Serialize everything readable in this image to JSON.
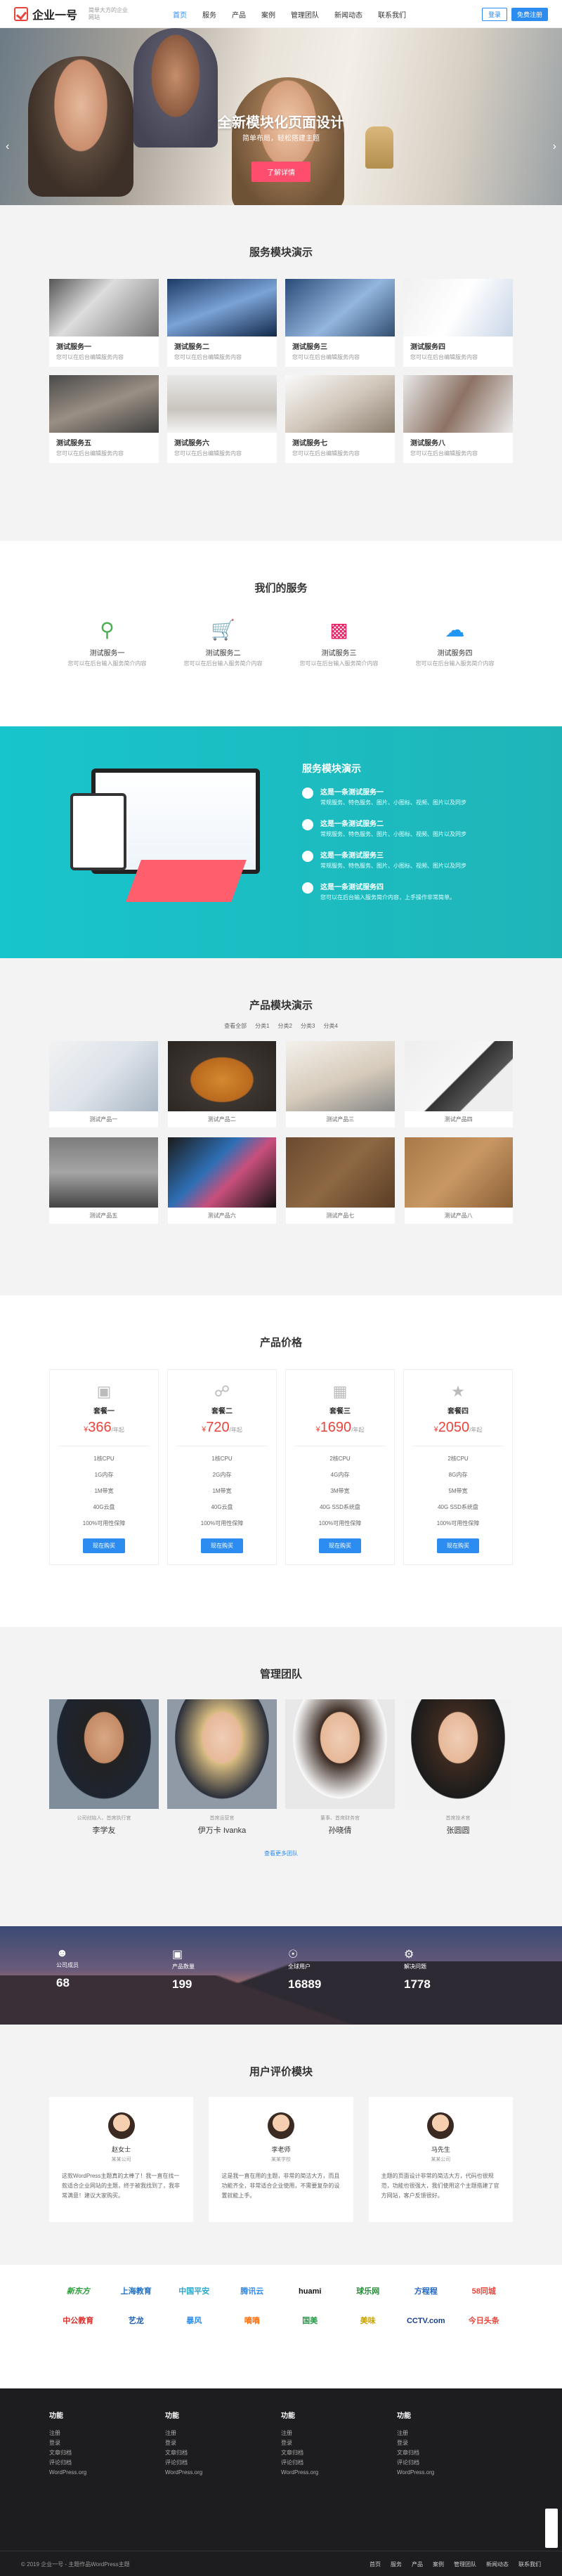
{
  "header": {
    "logo": "企业一号",
    "logo_sub": "简单大方的企业网站",
    "nav": [
      "首页",
      "服务",
      "产品",
      "案例",
      "管理团队",
      "新闻动态",
      "联系我们"
    ],
    "btn_login": "登录",
    "btn_signup": "免费注册"
  },
  "hero": {
    "title": "全新模块化页面设计",
    "subtitle": "简单布局，轻松搭建主题",
    "button": "了解详情"
  },
  "service_modules": {
    "title": "服务模块演示",
    "items": [
      {
        "name": "测试服务一",
        "desc": "您可以在后台编辑服务内容"
      },
      {
        "name": "测试服务二",
        "desc": "您可以在后台编辑服务内容"
      },
      {
        "name": "测试服务三",
        "desc": "您可以在后台编辑服务内容"
      },
      {
        "name": "测试服务四",
        "desc": "您可以在后台编辑服务内容"
      },
      {
        "name": "测试服务五",
        "desc": "您可以在后台编辑服务内容"
      },
      {
        "name": "测试服务六",
        "desc": "您可以在后台编辑服务内容"
      },
      {
        "name": "测试服务七",
        "desc": "您可以在后台编辑服务内容"
      },
      {
        "name": "测试服务八",
        "desc": "您可以在后台编辑服务内容"
      }
    ]
  },
  "our_services": {
    "title": "我们的服务",
    "items": [
      {
        "name": "测试服务一",
        "desc": "您可以在后台输入服务简介内容",
        "icon": "search-icon",
        "color": "#4caf50"
      },
      {
        "name": "测试服务二",
        "desc": "您可以在后台输入服务简介内容",
        "icon": "cart-icon",
        "color": "#ff9800"
      },
      {
        "name": "测试服务三",
        "desc": "您可以在后台输入服务简介内容",
        "icon": "chart-icon",
        "color": "#e91e63"
      },
      {
        "name": "测试服务四",
        "desc": "您可以在后台输入服务简介内容",
        "icon": "cloud-icon",
        "color": "#2196f3"
      }
    ]
  },
  "teal_block": {
    "title": "服务模块演示",
    "items": [
      {
        "name": "这是一条测试服务一",
        "desc": "常规服务、特色服务、图片、小图标、视频、图片以及同步"
      },
      {
        "name": "这是一条测试服务二",
        "desc": "常规服务、特色服务、图片、小图标、视频、图片以及同步"
      },
      {
        "name": "这是一条测试服务三",
        "desc": "常规服务、特色服务、图片、小图标、视频、图片以及同步"
      },
      {
        "name": "这是一条测试服务四",
        "desc": "您可以在后台输入服务简介内容，上手操作非常简单。"
      }
    ]
  },
  "products": {
    "title": "产品模块演示",
    "tabs": [
      "查看全部",
      "分类1",
      "分类2",
      "分类3",
      "分类4"
    ],
    "items": [
      "测试产品一",
      "测试产品二",
      "测试产品三",
      "测试产品四",
      "测试产品五",
      "测试产品六",
      "测试产品七",
      "测试产品八"
    ]
  },
  "pricing": {
    "title": "产品价格",
    "plans": [
      {
        "name": "套餐一",
        "currency": "¥",
        "price": "366",
        "unit": "/年起",
        "features": [
          "1核CPU",
          "1G内存",
          "1M带宽",
          "40G云盘",
          "100%可用性保障"
        ],
        "button": "现在购买"
      },
      {
        "name": "套餐二",
        "currency": "¥",
        "price": "720",
        "unit": "/年起",
        "features": [
          "1核CPU",
          "2G内存",
          "1M带宽",
          "40G云盘",
          "100%可用性保障"
        ],
        "button": "现在购买"
      },
      {
        "name": "套餐三",
        "currency": "¥",
        "price": "1690",
        "unit": "/年起",
        "features": [
          "2核CPU",
          "4G内存",
          "3M带宽",
          "40G SSD系统盘",
          "100%可用性保障"
        ],
        "button": "现在购买"
      },
      {
        "name": "套餐四",
        "currency": "¥",
        "price": "2050",
        "unit": "/年起",
        "features": [
          "2核CPU",
          "8G内存",
          "5M带宽",
          "40G SSD系统盘",
          "100%可用性保障"
        ],
        "button": "现在购买"
      }
    ]
  },
  "team": {
    "title": "管理团队",
    "members": [
      {
        "role": "公司创始人、首席执行官",
        "name": "李学友"
      },
      {
        "role": "首席运营官",
        "name": "伊万卡 Ivanka"
      },
      {
        "role": "董事、首席财务官",
        "name": "孙晓倩"
      },
      {
        "role": "首席技术官",
        "name": "张圆圆"
      }
    ],
    "more": "查看更多团队"
  },
  "stats": [
    {
      "label": "公司成员",
      "value": "68",
      "icon": "user-icon"
    },
    {
      "label": "产品数量",
      "value": "199",
      "icon": "monitor-icon"
    },
    {
      "label": "全球用户",
      "value": "16889",
      "icon": "globe-icon"
    },
    {
      "label": "解决问题",
      "value": "1778",
      "icon": "support-icon"
    }
  ],
  "reviews": {
    "title": "用户评价模块",
    "items": [
      {
        "name": "赵女士",
        "role": "某某公司",
        "text": "这款WordPress主题真的太棒了！我一直在找一款适合企业网站的主题，终于被我找到了，我非常满意！建议大家购买。"
      },
      {
        "name": "李老师",
        "role": "某某学校",
        "text": "这是我一直在用的主题，非常的简洁大方，而且功能齐全，非常适合企业使用，不需要复杂的设置就能上手。"
      },
      {
        "name": "马先生",
        "role": "某某公司",
        "text": "主题的页面设计非常的简洁大方，代码也很规范，功能也很强大，我们使用这个主题搭建了官方网站，客户反馈很好。"
      }
    ]
  },
  "partners": [
    "新东方",
    "上海教育",
    "中国平安",
    "腾讯云",
    "huami",
    "球乐网",
    "方程程",
    "58同城",
    "中公教育",
    "艺龙",
    "暴风",
    "嘀嘀",
    "国美",
    "美味",
    "CCTV.com",
    "今日头条"
  ],
  "footer": {
    "columns": [
      {
        "title": "功能",
        "links": [
          "注册",
          "登录",
          "文章归档",
          "评论归档",
          "WordPress.org"
        ]
      },
      {
        "title": "功能",
        "links": [
          "注册",
          "登录",
          "文章归档",
          "评论归档",
          "WordPress.org"
        ]
      },
      {
        "title": "功能",
        "links": [
          "注册",
          "登录",
          "文章归档",
          "评论归档",
          "WordPress.org"
        ]
      },
      {
        "title": "功能",
        "links": [
          "注册",
          "登录",
          "文章归档",
          "评论归档",
          "WordPress.org"
        ]
      }
    ],
    "copyright": "© 2019 企业一号 - 主题作品WordPress主题",
    "links": [
      "首页",
      "服务",
      "产品",
      "案例",
      "管理团队",
      "新闻动态",
      "联系我们"
    ]
  }
}
